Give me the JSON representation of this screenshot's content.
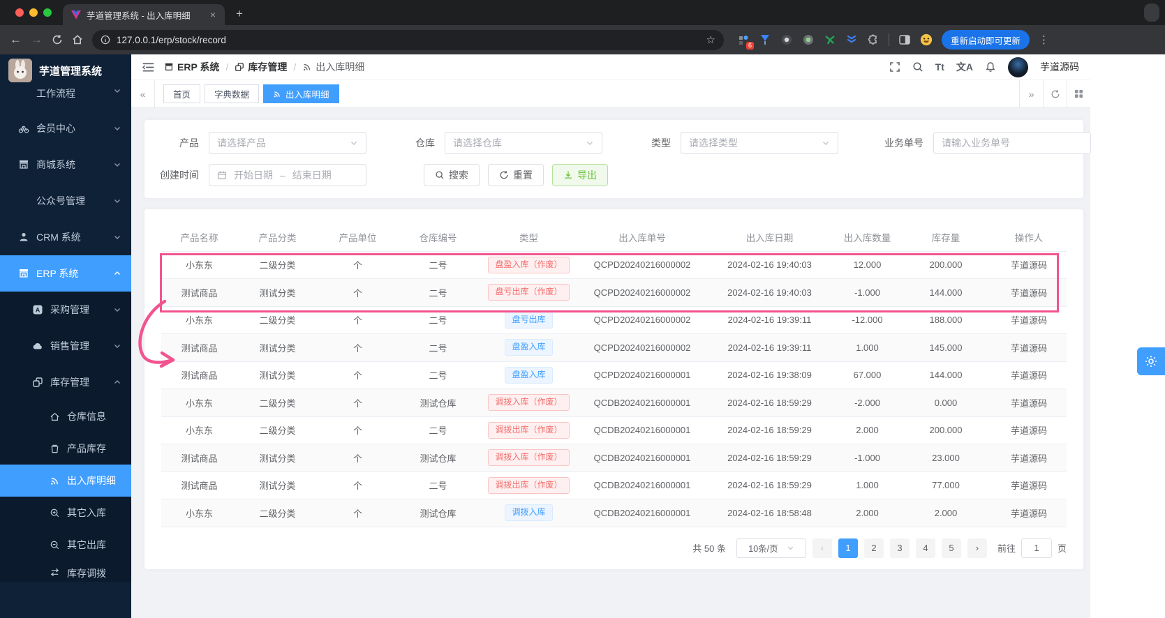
{
  "browser": {
    "tab_title": "芋道管理系统 - 出入库明细",
    "url": "127.0.0.1/erp/stock/record",
    "extension_badge": "6",
    "update_button": "重新启动即可更新"
  },
  "sidebar": {
    "logo_title": "芋道管理系统",
    "top_items": [
      {
        "label": "工作流程"
      },
      {
        "label": "会员中心"
      },
      {
        "label": "商城系统"
      },
      {
        "label": "公众号管理"
      },
      {
        "label": "CRM 系统"
      },
      {
        "label": "ERP 系统"
      }
    ],
    "erp_children": [
      {
        "label": "采购管理"
      },
      {
        "label": "销售管理"
      },
      {
        "label": "库存管理"
      }
    ],
    "stock_children": [
      {
        "label": "仓库信息"
      },
      {
        "label": "产品库存"
      },
      {
        "label": "出入库明细"
      },
      {
        "label": "其它入库"
      },
      {
        "label": "其它出库"
      },
      {
        "label": "库存调拨"
      }
    ]
  },
  "header": {
    "breadcrumb": [
      "ERP 系统",
      "库存管理",
      "出入库明细"
    ],
    "font_size_icon": "Tt",
    "locale_icon": "文A",
    "username": "芋道源码"
  },
  "tags": {
    "tabs": [
      {
        "label": "首页",
        "active": false
      },
      {
        "label": "字典数据",
        "active": false
      },
      {
        "label": "出入库明细",
        "active": true
      }
    ]
  },
  "filters": {
    "product_label": "产品",
    "product_placeholder": "请选择产品",
    "warehouse_label": "仓库",
    "warehouse_placeholder": "请选择仓库",
    "type_label": "类型",
    "type_placeholder": "请选择类型",
    "bizno_label": "业务单号",
    "bizno_placeholder": "请输入业务单号",
    "time_label": "创建时间",
    "date_start": "开始日期",
    "date_separator": "–",
    "date_end": "结束日期",
    "search_label": "搜索",
    "reset_label": "重置",
    "export_label": "导出"
  },
  "table": {
    "columns": [
      "产品名称",
      "产品分类",
      "产品单位",
      "仓库编号",
      "类型",
      "出入库单号",
      "出入库日期",
      "出入库数量",
      "库存量",
      "操作人"
    ],
    "rows": [
      {
        "product": "小东东",
        "category": "二级分类",
        "unit": "个",
        "warehouse": "二号",
        "type": "盘盈入库（作废）",
        "type_style": "danger",
        "record_no": "QCPD20240216000002",
        "date": "2024-02-16 19:40:03",
        "qty": "12.000",
        "stock": "200.000",
        "operator": "芋道源码"
      },
      {
        "product": "测试商品",
        "category": "测试分类",
        "unit": "个",
        "warehouse": "二号",
        "type": "盘亏出库（作废）",
        "type_style": "danger",
        "record_no": "QCPD20240216000002",
        "date": "2024-02-16 19:40:03",
        "qty": "-1.000",
        "stock": "144.000",
        "operator": "芋道源码"
      },
      {
        "product": "小东东",
        "category": "二级分类",
        "unit": "个",
        "warehouse": "二号",
        "type": "盘亏出库",
        "type_style": "primary",
        "record_no": "QCPD20240216000002",
        "date": "2024-02-16 19:39:11",
        "qty": "-12.000",
        "stock": "188.000",
        "operator": "芋道源码"
      },
      {
        "product": "测试商品",
        "category": "测试分类",
        "unit": "个",
        "warehouse": "二号",
        "type": "盘盈入库",
        "type_style": "primary",
        "record_no": "QCPD20240216000002",
        "date": "2024-02-16 19:39:11",
        "qty": "1.000",
        "stock": "145.000",
        "operator": "芋道源码"
      },
      {
        "product": "测试商品",
        "category": "测试分类",
        "unit": "个",
        "warehouse": "二号",
        "type": "盘盈入库",
        "type_style": "primary",
        "record_no": "QCPD20240216000001",
        "date": "2024-02-16 19:38:09",
        "qty": "67.000",
        "stock": "144.000",
        "operator": "芋道源码"
      },
      {
        "product": "小东东",
        "category": "二级分类",
        "unit": "个",
        "warehouse": "测试仓库",
        "type": "调拨入库（作废）",
        "type_style": "danger",
        "record_no": "QCDB20240216000001",
        "date": "2024-02-16 18:59:29",
        "qty": "-2.000",
        "stock": "0.000",
        "operator": "芋道源码"
      },
      {
        "product": "小东东",
        "category": "二级分类",
        "unit": "个",
        "warehouse": "二号",
        "type": "调拨出库（作废）",
        "type_style": "danger",
        "record_no": "QCDB20240216000001",
        "date": "2024-02-16 18:59:29",
        "qty": "2.000",
        "stock": "200.000",
        "operator": "芋道源码"
      },
      {
        "product": "测试商品",
        "category": "测试分类",
        "unit": "个",
        "warehouse": "测试仓库",
        "type": "调拨入库（作废）",
        "type_style": "danger",
        "record_no": "QCDB20240216000001",
        "date": "2024-02-16 18:59:29",
        "qty": "-1.000",
        "stock": "23.000",
        "operator": "芋道源码"
      },
      {
        "product": "测试商品",
        "category": "测试分类",
        "unit": "个",
        "warehouse": "二号",
        "type": "调拨出库（作废）",
        "type_style": "danger",
        "record_no": "QCDB20240216000001",
        "date": "2024-02-16 18:59:29",
        "qty": "1.000",
        "stock": "77.000",
        "operator": "芋道源码"
      },
      {
        "product": "小东东",
        "category": "二级分类",
        "unit": "个",
        "warehouse": "测试仓库",
        "type": "调拨入库",
        "type_style": "primary",
        "record_no": "QCDB20240216000001",
        "date": "2024-02-16 18:58:48",
        "qty": "2.000",
        "stock": "2.000",
        "operator": "芋道源码"
      }
    ]
  },
  "pagination": {
    "total": "共 50 条",
    "page_size": "10条/页",
    "pages": [
      "1",
      "2",
      "3",
      "4",
      "5"
    ],
    "active_page": "1",
    "goto_label": "前往",
    "goto_value": "1",
    "page_unit": "页"
  },
  "colors": {
    "accent": "#409eff",
    "danger": "#f56c6c",
    "success": "#67c23a",
    "annotation": "#f2548f",
    "sidebar_bg": "#0f2137"
  }
}
